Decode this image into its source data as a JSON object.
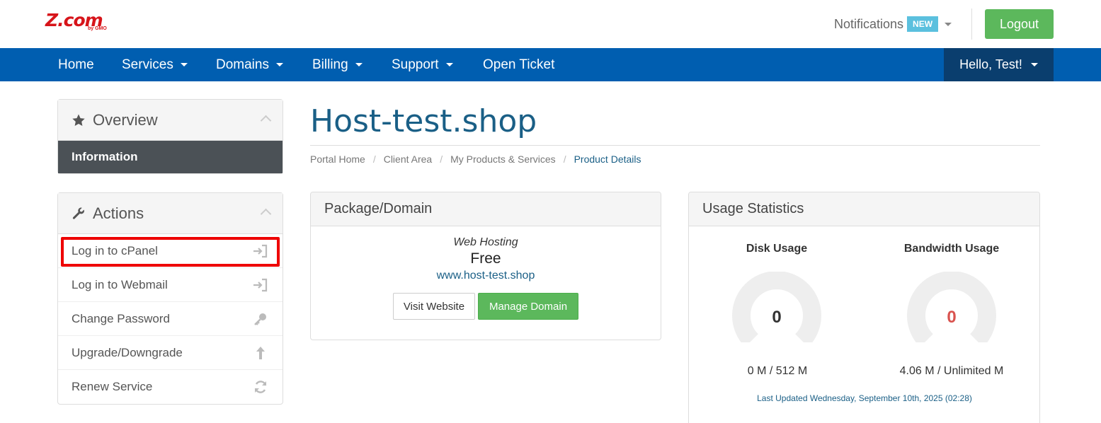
{
  "header": {
    "logo_text": "Z.com",
    "logo_sub": "by GMO",
    "notifications_label": "Notifications",
    "notifications_badge": "NEW",
    "logout_label": "Logout"
  },
  "nav": {
    "items": [
      {
        "label": "Home"
      },
      {
        "label": "Services"
      },
      {
        "label": "Domains"
      },
      {
        "label": "Billing"
      },
      {
        "label": "Support"
      },
      {
        "label": "Open Ticket"
      }
    ],
    "user_label": "Hello, Test!"
  },
  "sidebar": {
    "overview": {
      "title": "Overview",
      "icon": "star-icon",
      "items": [
        {
          "label": "Information",
          "active": true
        }
      ]
    },
    "actions": {
      "title": "Actions",
      "icon": "wrench-icon",
      "items": [
        {
          "label": "Log in to cPanel",
          "icon": "sign-in-icon"
        },
        {
          "label": "Log in to Webmail",
          "icon": "sign-in-icon"
        },
        {
          "label": "Change Password",
          "icon": "key-icon"
        },
        {
          "label": "Upgrade/Downgrade",
          "icon": "arrow-up-icon"
        },
        {
          "label": "Renew Service",
          "icon": "refresh-icon"
        }
      ]
    }
  },
  "main": {
    "title": "Host-test.shop",
    "breadcrumb": [
      "Portal Home",
      "Client Area",
      "My Products & Services",
      "Product Details"
    ],
    "package": {
      "header": "Package/Domain",
      "type": "Web Hosting",
      "price": "Free",
      "domain": "www.host-test.shop",
      "visit_label": "Visit Website",
      "manage_label": "Manage Domain"
    },
    "usage": {
      "header": "Usage Statistics",
      "disk": {
        "label": "Disk Usage",
        "value": "0",
        "detail": "0 M / 512 M",
        "value_color": "#333333"
      },
      "bandwidth": {
        "label": "Bandwidth Usage",
        "value": "0",
        "detail": "4.06 M / Unlimited M",
        "value_color": "#d9534f"
      },
      "last_updated": "Last Updated Wednesday, September 10th, 2025 (02:28)"
    }
  },
  "colors": {
    "brand_red": "#d7141a",
    "nav_blue": "#005eb0",
    "nav_dark": "#0a3e6e",
    "success_green": "#5cb85c",
    "link_blue": "#1a5f86",
    "highlight_red": "#ee0000"
  }
}
